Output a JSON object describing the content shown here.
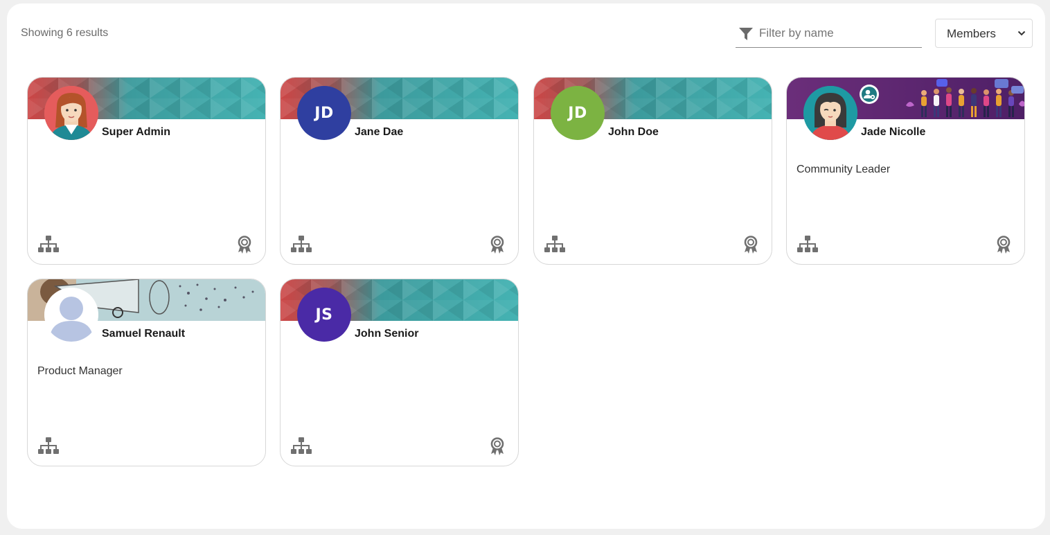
{
  "header": {
    "results_text": "Showing 6 results",
    "filter_placeholder": "Filter by name",
    "select_value": "Members"
  },
  "members": [
    {
      "name": "Super Admin",
      "role": "",
      "initials": "",
      "avatar": "woman-illustration"
    },
    {
      "name": "Jane Dae",
      "role": "",
      "initials": "JD",
      "avatar_color": "#2f3fa0"
    },
    {
      "name": "John Doe",
      "role": "",
      "initials": "JD",
      "avatar_color": "#7cb342"
    },
    {
      "name": "Jade Nicolle",
      "role": "Community Leader",
      "initials": "",
      "avatar": "woman-illustration-teal",
      "admin_badge": "user-gear-icon"
    },
    {
      "name": "Samuel Renault",
      "role": "Product Manager",
      "initials": "",
      "avatar": "default-silhouette"
    },
    {
      "name": "John Senior",
      "role": "",
      "initials": "JS",
      "avatar_color": "#4a2aa6"
    }
  ],
  "colors": {
    "banner_red": "#c94b4b",
    "banner_teal": "#3a9da0",
    "community_purple": "#5e2a72",
    "icon_gray": "#707070"
  }
}
